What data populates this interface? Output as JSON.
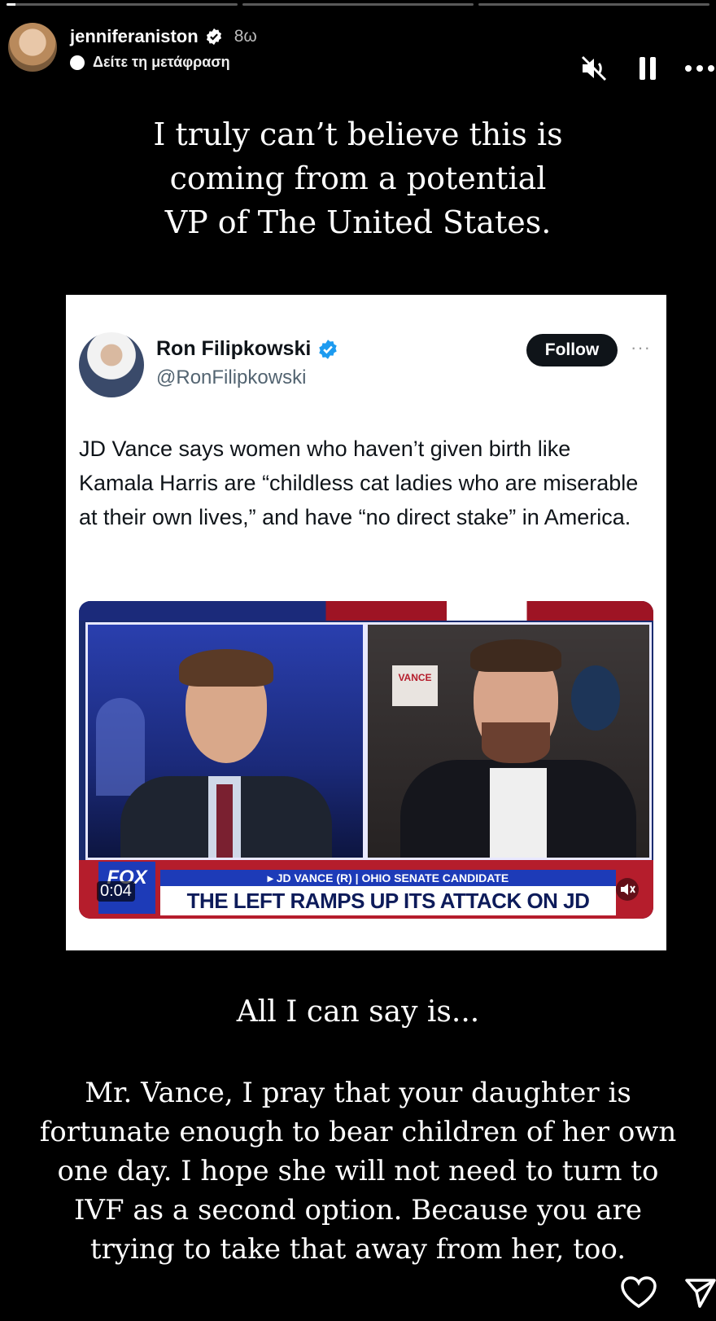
{
  "story": {
    "progress": [
      {
        "fill_fraction": 0.04
      },
      {
        "fill_fraction": 0
      },
      {
        "fill_fraction": 0
      }
    ],
    "header": {
      "username": "jenniferaniston",
      "time": "8ω",
      "translate_label": "Δείτε τη μετάφραση",
      "verified_color": "#ffffff"
    },
    "controls": {
      "mute_icon": "speaker-muted-icon",
      "pause_icon": "pause-icon",
      "more_icon": "more-dots-icon"
    },
    "caption_top": [
      "I truly can’t believe this is",
      "coming from a potential",
      "VP of The United States."
    ],
    "tweet": {
      "name": "Ron Filipkowski",
      "handle": "@RonFilipkowski",
      "follow_label": "Follow",
      "more": "···",
      "verified_color": "#1d9bf0",
      "text": "JD Vance says women who haven’t given birth like Kamala Harris are “childless cat ladies who are miserable at their own lives,” and have “no direct stake” in America.",
      "video": {
        "logo": "FOX",
        "time": "0:04",
        "strap_small": "▸ JD VANCE (R) | OHIO SENATE CANDIDATE",
        "headline": "THE LEFT RAMPS UP ITS ATTACK ON JD VANCE",
        "sign": "VANCE"
      }
    },
    "caption_mid": "All I can say is...",
    "caption_bottom": "Mr. Vance, I pray that your daughter is fortunate enough to bear children of her own one day. I hope she will not need to turn to IVF as a second option. Because you are trying to take that away from her, too.",
    "footer": {
      "like_icon": "heart-icon",
      "share_icon": "send-icon"
    }
  }
}
